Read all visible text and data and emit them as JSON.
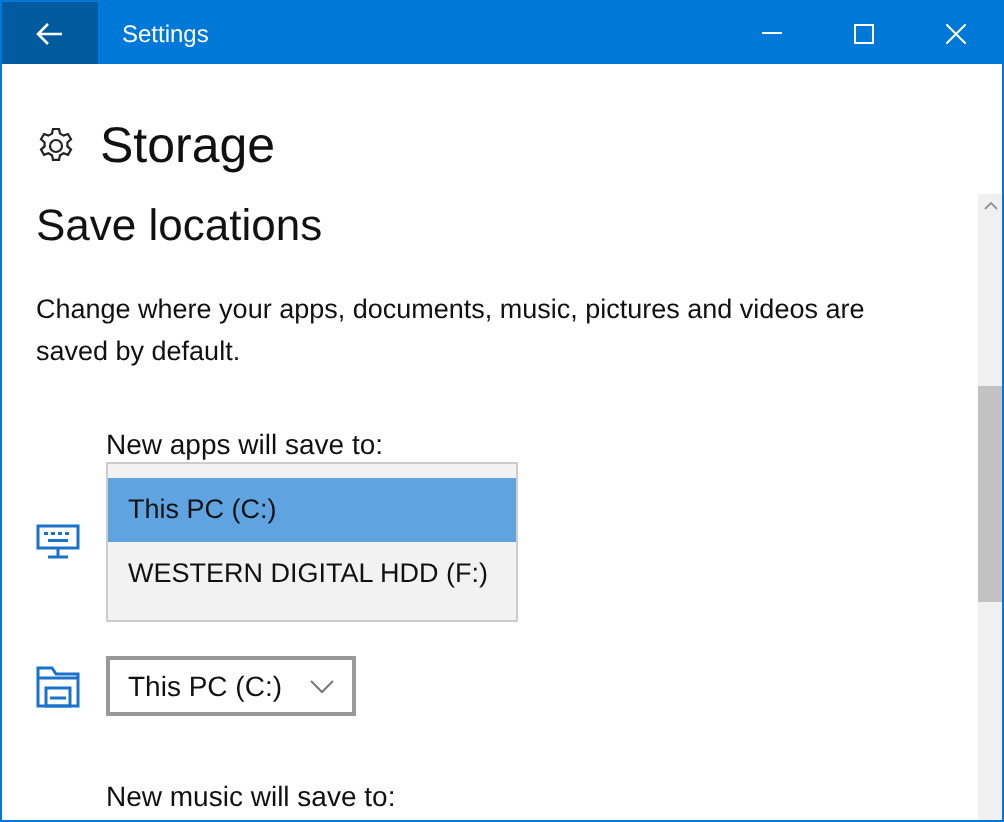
{
  "window": {
    "title": "Settings"
  },
  "page": {
    "title": "Storage"
  },
  "section": {
    "title": "Save locations",
    "description": "Change where your apps, documents, music, pictures and videos are saved by default."
  },
  "settings": [
    {
      "kind": "apps",
      "label": "New apps will save to:",
      "options": [
        {
          "label": "This PC (C:)",
          "selected": true
        },
        {
          "label": "WESTERN DIGITAL HDD (F:)",
          "selected": false
        }
      ]
    },
    {
      "kind": "documents",
      "value": "This PC (C:)"
    },
    {
      "kind": "music",
      "label": "New music will save to:"
    }
  ]
}
